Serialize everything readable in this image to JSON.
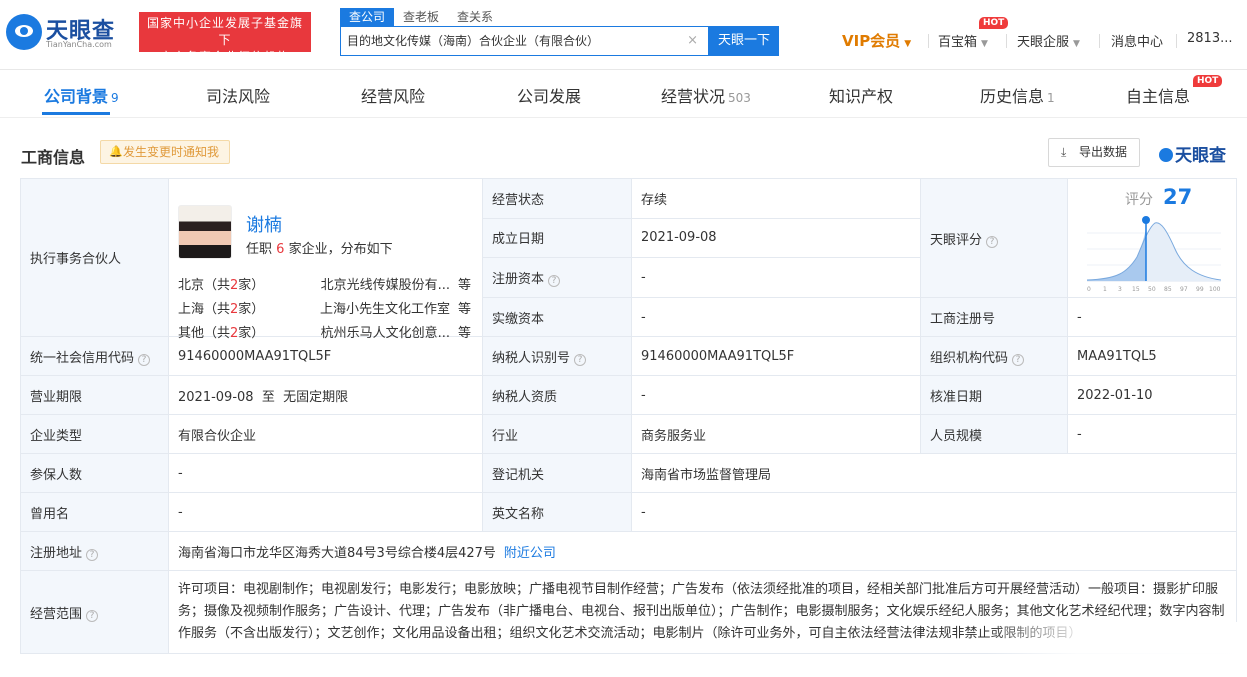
{
  "header": {
    "logo_text": "天眼查",
    "logo_sub": "TianYanCha.com",
    "slogan_line1": "国家中小企业发展子基金旗下",
    "slogan_line2": "官方备案企业征信机构",
    "search_tabs": [
      "查公司",
      "查老板",
      "查关系"
    ],
    "search_value": "目的地文化传媒（海南）合伙企业（有限合伙）",
    "search_clear": "×",
    "search_button": "天眼一下",
    "vip": "VIP会员",
    "baibaoxiang": "百宝箱",
    "hot": "HOT",
    "tianyan_qiye": "天眼企服",
    "messages": "消息中心",
    "user": "2813..."
  },
  "catnav": {
    "items": [
      {
        "label": "公司背景",
        "count": "9"
      },
      {
        "label": "司法风险",
        "count": ""
      },
      {
        "label": "经营风险",
        "count": ""
      },
      {
        "label": "公司发展",
        "count": ""
      },
      {
        "label": "经营状况",
        "count": "503"
      },
      {
        "label": "知识产权",
        "count": ""
      },
      {
        "label": "历史信息",
        "count": "1"
      },
      {
        "label": "自主信息",
        "count": ""
      }
    ],
    "hot": "HOT"
  },
  "section": {
    "title": "工商信息",
    "notify": "发生变更时通知我",
    "export": "导出数据",
    "brand": "天眼查"
  },
  "partner": {
    "label": "执行事务合伙人",
    "name": "谢楠",
    "desc_prefix": "任职",
    "desc_count": "6",
    "desc_suffix": "家企业，分布如下",
    "regions": [
      {
        "prefix": "北京（共",
        "count": "2",
        "suffix": "家）",
        "company": "北京光线传媒股份有...",
        "tail": "等"
      },
      {
        "prefix": "上海（共",
        "count": "2",
        "suffix": "家）",
        "company": "上海小先生文化工作室",
        "tail": "等"
      },
      {
        "prefix": "其他（共",
        "count": "2",
        "suffix": "家）",
        "company": "杭州乐马人文化创意...",
        "tail": "等"
      }
    ]
  },
  "fields": {
    "status_label": "经营状态",
    "status_value": "存续",
    "founded_label": "成立日期",
    "founded_value": "2021-09-08",
    "reg_capital_label": "注册资本",
    "reg_capital_value": "-",
    "paid_capital_label": "实缴资本",
    "paid_capital_value": "-",
    "score_label": "天眼评分",
    "score_title": "评分",
    "score_value": "27",
    "score_ticks": [
      "0",
      "1",
      "3",
      "15",
      "50",
      "85",
      "97",
      "99",
      "100"
    ],
    "reg_no_label": "工商注册号",
    "reg_no_value": "-",
    "credit_code_label": "统一社会信用代码",
    "credit_code_value": "91460000MAA91TQL5F",
    "taxpayer_id_label": "纳税人识别号",
    "taxpayer_id_value": "91460000MAA91TQL5F",
    "org_code_label": "组织机构代码",
    "org_code_value": "MAA91TQL5",
    "term_label": "营业期限",
    "term_value": "2021-09-08  至  无固定期限",
    "taxpayer_qual_label": "纳税人资质",
    "taxpayer_qual_value": "-",
    "approve_label": "核准日期",
    "approve_value": "2022-01-10",
    "type_label": "企业类型",
    "type_value": "有限合伙企业",
    "industry_label": "行业",
    "industry_value": "商务服务业",
    "staff_label": "人员规模",
    "staff_value": "-",
    "insured_label": "参保人数",
    "insured_value": "-",
    "authority_label": "登记机关",
    "authority_value": "海南省市场监督管理局",
    "former_name_label": "曾用名",
    "former_name_value": "-",
    "english_label": "英文名称",
    "english_value": "-",
    "address_label": "注册地址",
    "address_value": "海南省海口市龙华区海秀大道84号3号综合楼4层427号",
    "address_link": "附近公司",
    "scope_label": "经营范围",
    "scope_value": "许可项目：电视剧制作；电视剧发行；电影发行；电影放映；广播电视节目制作经营；广告发布（依法须经批准的项目，经相关部门批准后方可开展经营活动）一般项目：摄影扩印服务；摄像及视频制作服务；广告设计、代理；广告发布（非广播电台、电视台、报刊出版单位）；广告制作；电影摄制服务；文化娱乐经纪人服务；其他文化艺术经纪代理；数字内容制作服务（不含出版发行）；文艺创作；文化用品设备出租；组织文化艺术交流活动；电影制片（除许可业务外，可自主依法经营法律法规非禁止或限制的项目）"
  },
  "icons": {
    "question": "?",
    "bell": "🔔",
    "download": "⤓",
    "caret": "▼"
  }
}
